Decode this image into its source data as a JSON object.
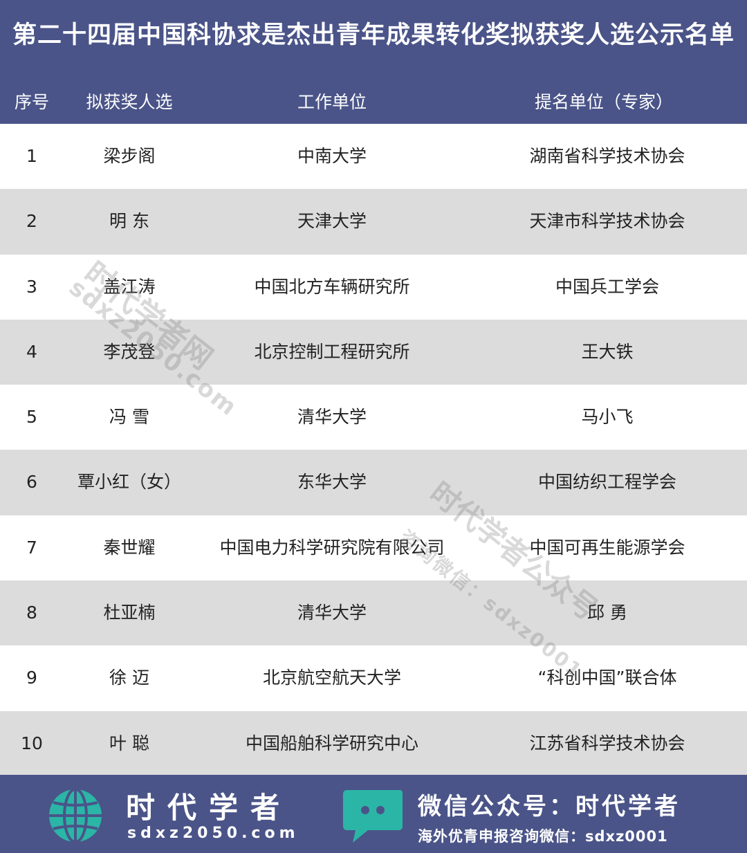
{
  "title": "第二十四届中国科协求是杰出青年成果转化奖拟获奖人选公示名单",
  "columns": {
    "index": "序号",
    "candidate": "拟获奖人选",
    "unit": "工作单位",
    "nominator": "提名单位（专家）"
  },
  "rows": [
    {
      "index": "1",
      "candidate": "梁步阁",
      "unit": "中南大学",
      "nominator": "湖南省科学技术协会"
    },
    {
      "index": "2",
      "candidate": "明  东",
      "unit": "天津大学",
      "nominator": "天津市科学技术协会"
    },
    {
      "index": "3",
      "candidate": "盖江涛",
      "unit": "中国北方车辆研究所",
      "nominator": "中国兵工学会"
    },
    {
      "index": "4",
      "candidate": "李茂登",
      "unit": "北京控制工程研究所",
      "nominator": "王大铁"
    },
    {
      "index": "5",
      "candidate": "冯  雪",
      "unit": "清华大学",
      "nominator": "马小飞"
    },
    {
      "index": "6",
      "candidate": "覃小红（女）",
      "unit": "东华大学",
      "nominator": "中国纺织工程学会"
    },
    {
      "index": "7",
      "candidate": "秦世耀",
      "unit": "中国电力科学研究院有限公司",
      "nominator": "中国可再生能源学会"
    },
    {
      "index": "8",
      "candidate": "杜亚楠",
      "unit": "清华大学",
      "nominator": "邱  勇"
    },
    {
      "index": "9",
      "candidate": "徐  迈",
      "unit": "北京航空航天大学",
      "nominator": "“科创中国”联合体"
    },
    {
      "index": "10",
      "candidate": "叶  聪",
      "unit": "中国船舶科学研究中心",
      "nominator": "江苏省科学技术协会"
    }
  ],
  "watermarks": {
    "wm1_main": "时代学者网",
    "wm1_url": "sdxz2050.com",
    "wm2_main": "时代学者公众号",
    "wm2_sub": "咨询微信：sdxz0001"
  },
  "footer": {
    "brand_name": "时代学者",
    "brand_url": "sdxz2050.com",
    "wechat_title": "微信公众号：时代学者",
    "wechat_sub": "海外优青申报咨询微信：sdxz0001"
  },
  "colors": {
    "header_bg": "#4a5488",
    "row_alt_bg": "#dcdcdc",
    "icon_teal": "#2bb5a6"
  },
  "icons": [
    "globe-icon",
    "chat-bubble-icon"
  ]
}
